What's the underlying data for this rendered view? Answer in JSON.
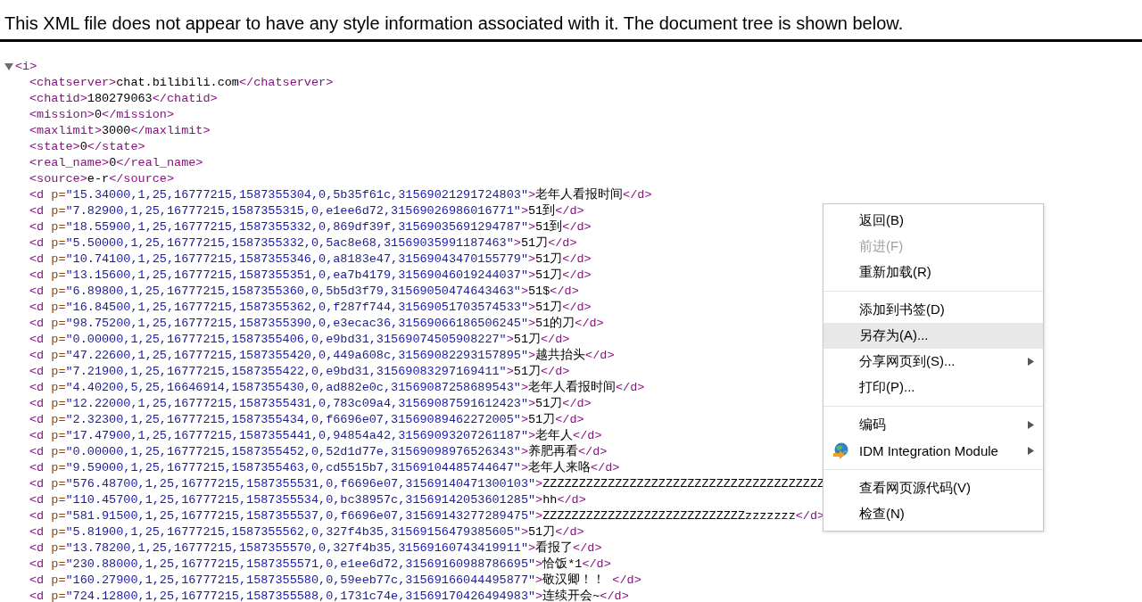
{
  "notice": "This XML file does not appear to have any style information associated with it. The document tree is shown below.",
  "tree": {
    "tag_text": "<i>",
    "expanded": true,
    "children": [
      {
        "tokens": [
          {
            "kind": "tag",
            "text": "<chatserver>"
          },
          {
            "kind": "text",
            "text": "chat.bilibili.com"
          },
          {
            "kind": "tag",
            "text": "</chatserver>"
          }
        ]
      },
      {
        "tokens": [
          {
            "kind": "tag",
            "text": "<chatid>"
          },
          {
            "kind": "text",
            "text": "180279063"
          },
          {
            "kind": "tag",
            "text": "</chatid>"
          }
        ]
      },
      {
        "tokens": [
          {
            "kind": "tag",
            "text": "<mission>"
          },
          {
            "kind": "text",
            "text": "0"
          },
          {
            "kind": "tag",
            "text": "</mission>"
          }
        ]
      },
      {
        "tokens": [
          {
            "kind": "tag",
            "text": "<maxlimit>"
          },
          {
            "kind": "text",
            "text": "3000"
          },
          {
            "kind": "tag",
            "text": "</maxlimit>"
          }
        ]
      },
      {
        "tokens": [
          {
            "kind": "tag",
            "text": "<state>"
          },
          {
            "kind": "text",
            "text": "0"
          },
          {
            "kind": "tag",
            "text": "</state>"
          }
        ]
      },
      {
        "tokens": [
          {
            "kind": "tag",
            "text": "<real_name>"
          },
          {
            "kind": "text",
            "text": "0"
          },
          {
            "kind": "tag",
            "text": "</real_name>"
          }
        ]
      },
      {
        "tokens": [
          {
            "kind": "tag",
            "text": "<source>"
          },
          {
            "kind": "text",
            "text": "e-r"
          },
          {
            "kind": "tag",
            "text": "</source>"
          }
        ]
      },
      {
        "tokens": [
          {
            "kind": "tag",
            "text": "<d "
          },
          {
            "kind": "attr-name",
            "text": "p="
          },
          {
            "kind": "attr-value",
            "text": "\"15.34000,1,25,16777215,1587355304,0,5b35f61c,31569021291724803\""
          },
          {
            "kind": "tag",
            "text": ">"
          },
          {
            "kind": "text",
            "text": "老年人看报时间"
          },
          {
            "kind": "tag",
            "text": "</d>"
          }
        ]
      },
      {
        "tokens": [
          {
            "kind": "tag",
            "text": "<d "
          },
          {
            "kind": "attr-name",
            "text": "p="
          },
          {
            "kind": "attr-value",
            "text": "\"7.82900,1,25,16777215,1587355315,0,e1ee6d72,31569026986016771\""
          },
          {
            "kind": "tag",
            "text": ">"
          },
          {
            "kind": "text",
            "text": "51到"
          },
          {
            "kind": "tag",
            "text": "</d>"
          }
        ]
      },
      {
        "tokens": [
          {
            "kind": "tag",
            "text": "<d "
          },
          {
            "kind": "attr-name",
            "text": "p="
          },
          {
            "kind": "attr-value",
            "text": "\"18.55900,1,25,16777215,1587355332,0,869df39f,31569035691294787\""
          },
          {
            "kind": "tag",
            "text": ">"
          },
          {
            "kind": "text",
            "text": "51到"
          },
          {
            "kind": "tag",
            "text": "</d>"
          }
        ]
      },
      {
        "tokens": [
          {
            "kind": "tag",
            "text": "<d "
          },
          {
            "kind": "attr-name",
            "text": "p="
          },
          {
            "kind": "attr-value",
            "text": "\"5.50000,1,25,16777215,1587355332,0,5ac8e68,31569035991187463\""
          },
          {
            "kind": "tag",
            "text": ">"
          },
          {
            "kind": "text",
            "text": "51刀"
          },
          {
            "kind": "tag",
            "text": "</d>"
          }
        ]
      },
      {
        "tokens": [
          {
            "kind": "tag",
            "text": "<d "
          },
          {
            "kind": "attr-name",
            "text": "p="
          },
          {
            "kind": "attr-value",
            "text": "\"10.74100,1,25,16777215,1587355346,0,a8183e47,31569043470155779\""
          },
          {
            "kind": "tag",
            "text": ">"
          },
          {
            "kind": "text",
            "text": "51刀"
          },
          {
            "kind": "tag",
            "text": "</d>"
          }
        ]
      },
      {
        "tokens": [
          {
            "kind": "tag",
            "text": "<d "
          },
          {
            "kind": "attr-name",
            "text": "p="
          },
          {
            "kind": "attr-value",
            "text": "\"13.15600,1,25,16777215,1587355351,0,ea7b4179,31569046019244037\""
          },
          {
            "kind": "tag",
            "text": ">"
          },
          {
            "kind": "text",
            "text": "51刀"
          },
          {
            "kind": "tag",
            "text": "</d>"
          }
        ]
      },
      {
        "tokens": [
          {
            "kind": "tag",
            "text": "<d "
          },
          {
            "kind": "attr-name",
            "text": "p="
          },
          {
            "kind": "attr-value",
            "text": "\"6.89800,1,25,16777215,1587355360,0,5b5d3f79,31569050474643463\""
          },
          {
            "kind": "tag",
            "text": ">"
          },
          {
            "kind": "text",
            "text": "51$"
          },
          {
            "kind": "tag",
            "text": "</d>"
          }
        ]
      },
      {
        "tokens": [
          {
            "kind": "tag",
            "text": "<d "
          },
          {
            "kind": "attr-name",
            "text": "p="
          },
          {
            "kind": "attr-value",
            "text": "\"16.84500,1,25,16777215,1587355362,0,f287f744,31569051703574533\""
          },
          {
            "kind": "tag",
            "text": ">"
          },
          {
            "kind": "text",
            "text": "51刀"
          },
          {
            "kind": "tag",
            "text": "</d>"
          }
        ]
      },
      {
        "tokens": [
          {
            "kind": "tag",
            "text": "<d "
          },
          {
            "kind": "attr-name",
            "text": "p="
          },
          {
            "kind": "attr-value",
            "text": "\"98.75200,1,25,16777215,1587355390,0,e3ecac36,31569066186506245\""
          },
          {
            "kind": "tag",
            "text": ">"
          },
          {
            "kind": "text",
            "text": "51的刀"
          },
          {
            "kind": "tag",
            "text": "</d>"
          }
        ]
      },
      {
        "tokens": [
          {
            "kind": "tag",
            "text": "<d "
          },
          {
            "kind": "attr-name",
            "text": "p="
          },
          {
            "kind": "attr-value",
            "text": "\"0.00000,1,25,16777215,1587355406,0,e9bd31,31569074505908227\""
          },
          {
            "kind": "tag",
            "text": ">"
          },
          {
            "kind": "text",
            "text": "51刀"
          },
          {
            "kind": "tag",
            "text": "</d>"
          }
        ]
      },
      {
        "tokens": [
          {
            "kind": "tag",
            "text": "<d "
          },
          {
            "kind": "attr-name",
            "text": "p="
          },
          {
            "kind": "attr-value",
            "text": "\"47.22600,1,25,16777215,1587355420,0,449a608c,31569082293157895\""
          },
          {
            "kind": "tag",
            "text": ">"
          },
          {
            "kind": "text",
            "text": "越共抬头"
          },
          {
            "kind": "tag",
            "text": "</d>"
          }
        ]
      },
      {
        "tokens": [
          {
            "kind": "tag",
            "text": "<d "
          },
          {
            "kind": "attr-name",
            "text": "p="
          },
          {
            "kind": "attr-value",
            "text": "\"7.21900,1,25,16777215,1587355422,0,e9bd31,31569083297169411\""
          },
          {
            "kind": "tag",
            "text": ">"
          },
          {
            "kind": "text",
            "text": "51刀"
          },
          {
            "kind": "tag",
            "text": "</d>"
          }
        ]
      },
      {
        "tokens": [
          {
            "kind": "tag",
            "text": "<d "
          },
          {
            "kind": "attr-name",
            "text": "p="
          },
          {
            "kind": "attr-value",
            "text": "\"4.40200,5,25,16646914,1587355430,0,ad882e0c,31569087258689543\""
          },
          {
            "kind": "tag",
            "text": ">"
          },
          {
            "kind": "text",
            "text": "老年人看报时间"
          },
          {
            "kind": "tag",
            "text": "</d>"
          }
        ]
      },
      {
        "tokens": [
          {
            "kind": "tag",
            "text": "<d "
          },
          {
            "kind": "attr-name",
            "text": "p="
          },
          {
            "kind": "attr-value",
            "text": "\"12.22000,1,25,16777215,1587355431,0,783c09a4,31569087591612423\""
          },
          {
            "kind": "tag",
            "text": ">"
          },
          {
            "kind": "text",
            "text": "51刀"
          },
          {
            "kind": "tag",
            "text": "</d>"
          }
        ]
      },
      {
        "tokens": [
          {
            "kind": "tag",
            "text": "<d "
          },
          {
            "kind": "attr-name",
            "text": "p="
          },
          {
            "kind": "attr-value",
            "text": "\"2.32300,1,25,16777215,1587355434,0,f6696e07,31569089462272005\""
          },
          {
            "kind": "tag",
            "text": ">"
          },
          {
            "kind": "text",
            "text": "51刀"
          },
          {
            "kind": "tag",
            "text": "</d>"
          }
        ]
      },
      {
        "tokens": [
          {
            "kind": "tag",
            "text": "<d "
          },
          {
            "kind": "attr-name",
            "text": "p="
          },
          {
            "kind": "attr-value",
            "text": "\"17.47900,1,25,16777215,1587355441,0,94854a42,31569093207261187\""
          },
          {
            "kind": "tag",
            "text": ">"
          },
          {
            "kind": "text",
            "text": "老年人"
          },
          {
            "kind": "tag",
            "text": "</d>"
          }
        ]
      },
      {
        "tokens": [
          {
            "kind": "tag",
            "text": "<d "
          },
          {
            "kind": "attr-name",
            "text": "p="
          },
          {
            "kind": "attr-value",
            "text": "\"0.00000,1,25,16777215,1587355452,0,52d1d77e,31569098976526343\""
          },
          {
            "kind": "tag",
            "text": ">"
          },
          {
            "kind": "text",
            "text": "养肥再看"
          },
          {
            "kind": "tag",
            "text": "</d>"
          }
        ]
      },
      {
        "tokens": [
          {
            "kind": "tag",
            "text": "<d "
          },
          {
            "kind": "attr-name",
            "text": "p="
          },
          {
            "kind": "attr-value",
            "text": "\"9.59000,1,25,16777215,1587355463,0,cd5515b7,31569104485744647\""
          },
          {
            "kind": "tag",
            "text": ">"
          },
          {
            "kind": "text",
            "text": "老年人来咯"
          },
          {
            "kind": "tag",
            "text": "</d>"
          }
        ]
      },
      {
        "tokens": [
          {
            "kind": "tag",
            "text": "<d "
          },
          {
            "kind": "attr-name",
            "text": "p="
          },
          {
            "kind": "attr-value",
            "text": "\"576.48700,1,25,16777215,1587355531,0,f6696e07,31569140471300103\""
          },
          {
            "kind": "tag",
            "text": ">"
          },
          {
            "kind": "text",
            "text": "ZZZZZZZZZZZZZZZZZZZZZZZZZZZZZZZZZZZZZZZ"
          }
        ]
      },
      {
        "tokens": [
          {
            "kind": "tag",
            "text": "<d "
          },
          {
            "kind": "attr-name",
            "text": "p="
          },
          {
            "kind": "attr-value",
            "text": "\"110.45700,1,25,16777215,1587355534,0,bc38957c,31569142053601285\""
          },
          {
            "kind": "tag",
            "text": ">"
          },
          {
            "kind": "text",
            "text": "hh"
          },
          {
            "kind": "tag",
            "text": "</d>"
          }
        ]
      },
      {
        "tokens": [
          {
            "kind": "tag",
            "text": "<d "
          },
          {
            "kind": "attr-name",
            "text": "p="
          },
          {
            "kind": "attr-value",
            "text": "\"581.91500,1,25,16777215,1587355537,0,f6696e07,31569143277289475\""
          },
          {
            "kind": "tag",
            "text": ">"
          },
          {
            "kind": "text",
            "text": "ZZZZZZZZZZZZZZZZZZZZZZZZZZZZzzzzzzz"
          },
          {
            "kind": "tag",
            "text": "</d>"
          }
        ]
      },
      {
        "tokens": [
          {
            "kind": "tag",
            "text": "<d "
          },
          {
            "kind": "attr-name",
            "text": "p="
          },
          {
            "kind": "attr-value",
            "text": "\"5.81900,1,25,16777215,1587355562,0,327f4b35,31569156479385605\""
          },
          {
            "kind": "tag",
            "text": ">"
          },
          {
            "kind": "text",
            "text": "51刀"
          },
          {
            "kind": "tag",
            "text": "</d>"
          }
        ]
      },
      {
        "tokens": [
          {
            "kind": "tag",
            "text": "<d "
          },
          {
            "kind": "attr-name",
            "text": "p="
          },
          {
            "kind": "attr-value",
            "text": "\"13.78200,1,25,16777215,1587355570,0,327f4b35,31569160743419911\""
          },
          {
            "kind": "tag",
            "text": ">"
          },
          {
            "kind": "text",
            "text": "看报了"
          },
          {
            "kind": "tag",
            "text": "</d>"
          }
        ]
      },
      {
        "tokens": [
          {
            "kind": "tag",
            "text": "<d "
          },
          {
            "kind": "attr-name",
            "text": "p="
          },
          {
            "kind": "attr-value",
            "text": "\"230.88000,1,25,16777215,1587355571,0,e1ee6d72,31569160988786695\""
          },
          {
            "kind": "tag",
            "text": ">"
          },
          {
            "kind": "text",
            "text": "恰饭*1"
          },
          {
            "kind": "tag",
            "text": "</d>"
          }
        ]
      },
      {
        "tokens": [
          {
            "kind": "tag",
            "text": "<d "
          },
          {
            "kind": "attr-name",
            "text": "p="
          },
          {
            "kind": "attr-value",
            "text": "\"160.27900,1,25,16777215,1587355580,0,59eeb77c,31569166044495877\""
          },
          {
            "kind": "tag",
            "text": ">"
          },
          {
            "kind": "text",
            "text": "敬汉卿！！ "
          },
          {
            "kind": "tag",
            "text": "</d>"
          }
        ]
      },
      {
        "tokens": [
          {
            "kind": "tag",
            "text": "<d "
          },
          {
            "kind": "attr-name",
            "text": "p="
          },
          {
            "kind": "attr-value",
            "text": "\"724.12800,1,25,16777215,1587355588,0,1731c74e,31569170426494983\""
          },
          {
            "kind": "tag",
            "text": ">"
          },
          {
            "kind": "text",
            "text": "连续开会~"
          },
          {
            "kind": "tag",
            "text": "</d>"
          }
        ]
      }
    ]
  },
  "context_menu": {
    "groups": [
      [
        {
          "label": "返回(B)",
          "kind": "plain",
          "disabled": false,
          "selected": false,
          "submenu": false
        },
        {
          "label": "前进(F)",
          "kind": "plain",
          "disabled": true,
          "selected": false,
          "submenu": false
        },
        {
          "label": "重新加载(R)",
          "kind": "plain",
          "disabled": false,
          "selected": false,
          "submenu": false
        }
      ],
      [
        {
          "label": "添加到书签(D)",
          "kind": "plain",
          "disabled": false,
          "selected": false,
          "submenu": false
        },
        {
          "label": "另存为(A)...",
          "kind": "plain",
          "disabled": false,
          "selected": true,
          "submenu": false
        },
        {
          "label": "分享网页到(S)...",
          "kind": "plain",
          "disabled": false,
          "selected": false,
          "submenu": true
        },
        {
          "label": "打印(P)...",
          "kind": "plain",
          "disabled": false,
          "selected": false,
          "submenu": false
        }
      ],
      [
        {
          "label": "编码",
          "kind": "plain",
          "disabled": false,
          "selected": false,
          "submenu": true
        },
        {
          "label": "IDM Integration Module",
          "kind": "with-icon",
          "disabled": false,
          "selected": false,
          "submenu": true
        }
      ],
      [
        {
          "label": "查看网页源代码(V)",
          "kind": "plain",
          "disabled": false,
          "selected": false,
          "submenu": false
        },
        {
          "label": "检查(N)",
          "kind": "plain",
          "disabled": false,
          "selected": false,
          "submenu": false
        }
      ]
    ]
  }
}
